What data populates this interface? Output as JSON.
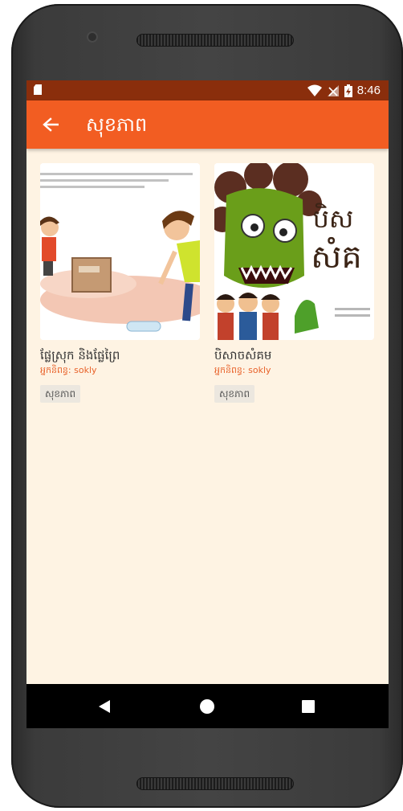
{
  "status_bar": {
    "time": "8:46"
  },
  "app_bar": {
    "title": "សុខភាព"
  },
  "books": [
    {
      "title": "ផ្លែស្រុក និងផ្លែព្រៃ",
      "author": "អ្នកនិពន្ធ: sokly",
      "tag": "សុខភាព"
    },
    {
      "title": "បិសាចសំគម",
      "author": "អ្នកនិពន្ធ: sokly",
      "tag": "សុខភាព"
    }
  ],
  "icons": {
    "back": "arrow-left",
    "sim": "sim-card",
    "wifi": "wifi-full",
    "signal": "signal-no-data",
    "battery": "battery-charging",
    "nav_back": "triangle-left",
    "nav_home": "circle",
    "nav_recent": "square"
  },
  "colors": {
    "app_bar": "#f25d22",
    "status_bar": "#8a2e0c",
    "background": "#fef3e3",
    "author_text": "#e8622a"
  }
}
